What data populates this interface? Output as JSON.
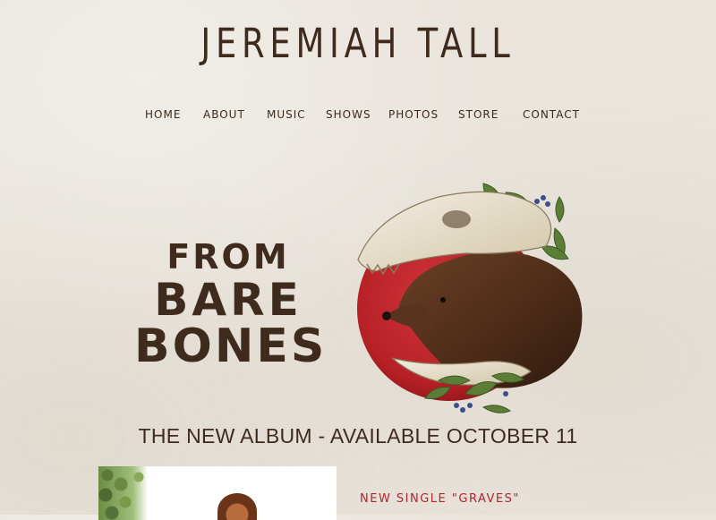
{
  "site": {
    "title": "JEREMIAH TALL"
  },
  "nav": {
    "items": [
      {
        "label": "HOME"
      },
      {
        "label": "ABOUT"
      },
      {
        "label": "MUSIC"
      },
      {
        "label": "SHOWS"
      },
      {
        "label": "PHOTOS"
      },
      {
        "label": "STORE"
      },
      {
        "label": "CONTACT"
      }
    ]
  },
  "hero": {
    "album_line1": "FROM",
    "album_line2": "BARE",
    "album_line3": "BONES",
    "art_icon": "bear-skull-moon-illustration",
    "tagline": "THE NEW ALBUM - AVAILABLE OCTOBER 11"
  },
  "feature": {
    "photo_icon": "artist-photo",
    "single_label": "NEW SINGLE \"GRAVES\""
  },
  "colors": {
    "background": "#e9e4dc",
    "ink": "#3f2b1d",
    "accent_red": "#b4252c",
    "moon_red": "#c1272d"
  }
}
